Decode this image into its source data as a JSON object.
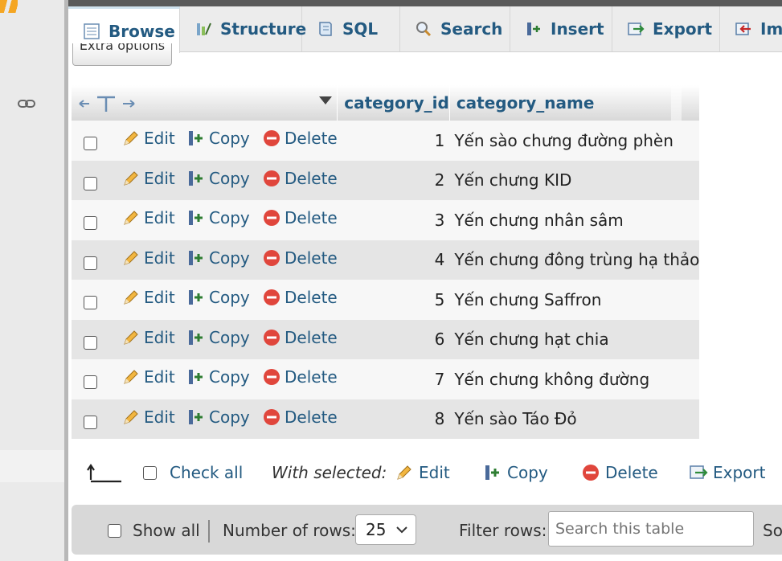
{
  "tabs": [
    {
      "label": "Browse",
      "icon": "browse-icon",
      "active": true
    },
    {
      "label": "Structure",
      "icon": "structure-icon"
    },
    {
      "label": "SQL",
      "icon": "sql-icon"
    },
    {
      "label": "Search",
      "icon": "search-icon"
    },
    {
      "label": "Insert",
      "icon": "insert-icon"
    },
    {
      "label": "Export",
      "icon": "export-icon"
    },
    {
      "label": "Im",
      "icon": "import-icon"
    }
  ],
  "extra_options_label": "Extra options",
  "table": {
    "columns": [
      "category_id",
      "category_name"
    ],
    "actions": {
      "edit": "Edit",
      "copy": "Copy",
      "delete": "Delete"
    },
    "rows": [
      {
        "id": "1",
        "name": "Yến sào chưng đường phèn"
      },
      {
        "id": "2",
        "name": "Yến chưng KID"
      },
      {
        "id": "3",
        "name": "Yến chưng nhân sâm"
      },
      {
        "id": "4",
        "name": "Yến chưng đông trùng hạ thảo"
      },
      {
        "id": "5",
        "name": "Yến chưng Saffron"
      },
      {
        "id": "6",
        "name": "Yến chưng hạt chia"
      },
      {
        "id": "7",
        "name": "Yến chưng không đường"
      },
      {
        "id": "8",
        "name": "Yến sào Táo Đỏ"
      }
    ]
  },
  "bulk": {
    "check_all": "Check all",
    "with_selected": "With selected:",
    "edit": "Edit",
    "copy": "Copy",
    "delete": "Delete",
    "export": "Export"
  },
  "footer": {
    "show_all": "Show all",
    "rows_label": "Number of rows:",
    "rows_value": "25",
    "filter_label": "Filter rows:",
    "search_placeholder": "Search this table",
    "sort_fragment": "So"
  },
  "colors": {
    "link": "#235a81",
    "accent": "#f5a623"
  }
}
